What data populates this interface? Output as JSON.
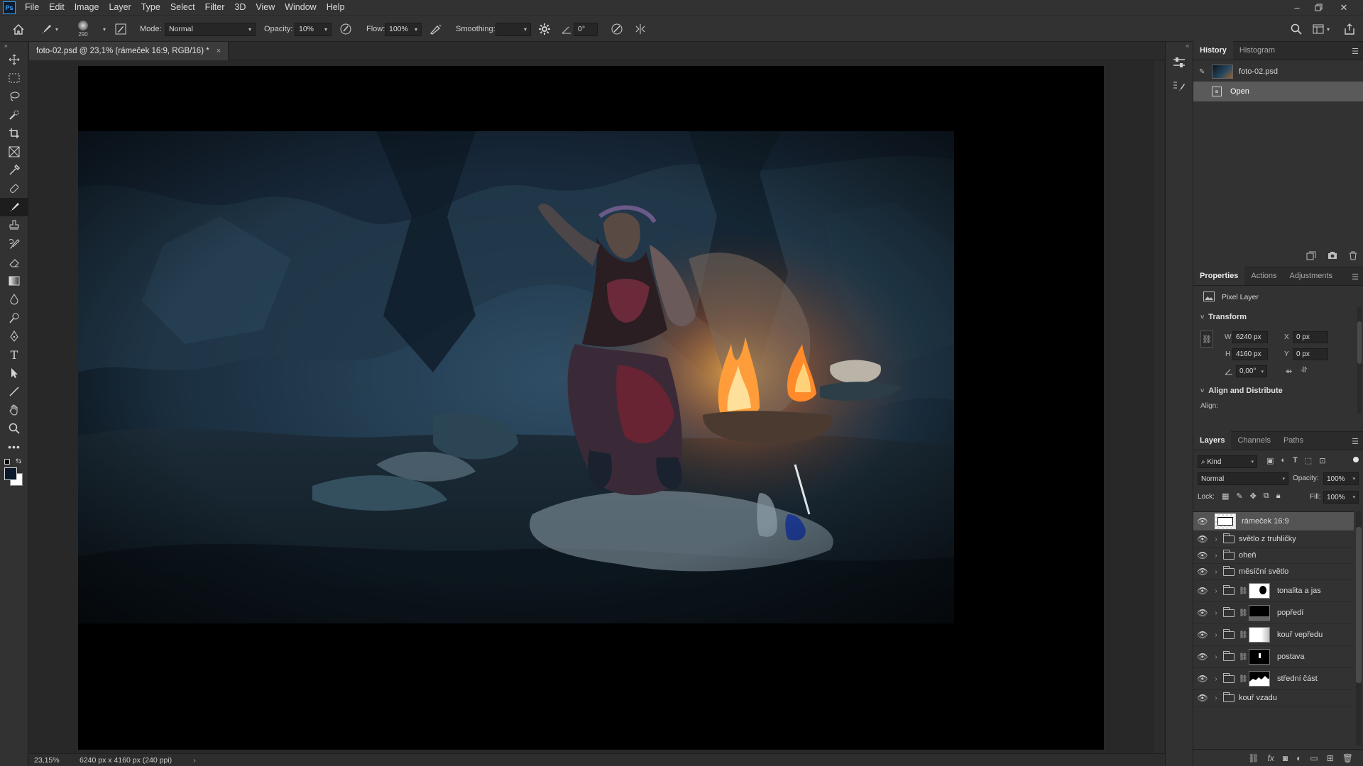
{
  "app": {
    "logo": "Ps"
  },
  "menu": [
    "File",
    "Edit",
    "Image",
    "Layer",
    "Type",
    "Select",
    "Filter",
    "3D",
    "View",
    "Window",
    "Help"
  ],
  "options": {
    "brush_size": "290",
    "mode_label": "Mode:",
    "mode_value": "Normal",
    "opacity_label": "Opacity:",
    "opacity_value": "10%",
    "flow_label": "Flow:",
    "flow_value": "100%",
    "smoothing_label": "Smoothing:",
    "smoothing_value": "",
    "angle_value": "0°"
  },
  "document": {
    "tab_title": "foto-02.psd @ 23,1% (rámeček 16:9, RGB/16) *",
    "close_glyph": "×"
  },
  "status": {
    "zoom": "23,15%",
    "info": "6240 px x 4160 px (240 ppi)",
    "arrow": "›"
  },
  "history": {
    "tabs": [
      "History",
      "Histogram"
    ],
    "snapshot_label": "foto-02.psd",
    "items": [
      "Open"
    ]
  },
  "properties": {
    "tabs": [
      "Properties",
      "Actions",
      "Adjustments"
    ],
    "layer_type": "Pixel Layer",
    "transform_title": "Transform",
    "w_label": "W",
    "w_value": "6240 px",
    "h_label": "H",
    "h_value": "4160 px",
    "x_label": "X",
    "x_value": "0 px",
    "y_label": "Y",
    "y_value": "0 px",
    "angle_value": "0,00°",
    "align_title": "Align and Distribute",
    "align_label": "Align:"
  },
  "layers": {
    "tabs": [
      "Layers",
      "Channels",
      "Paths"
    ],
    "filter_kind": "Kind",
    "blend_mode": "Normal",
    "opacity_label": "Opacity:",
    "opacity_value": "100%",
    "lock_label": "Lock:",
    "fill_label": "Fill:",
    "fill_value": "100%",
    "items": [
      {
        "name": "rámeček 16:9",
        "type": "pixel"
      },
      {
        "name": "světlo z truhličky",
        "type": "group"
      },
      {
        "name": "oheň",
        "type": "group"
      },
      {
        "name": "měsíční světlo",
        "type": "group"
      },
      {
        "name": "tonalita a jas",
        "type": "group-mask"
      },
      {
        "name": "popředí",
        "type": "group-mask"
      },
      {
        "name": "kouř vepředu",
        "type": "group-mask"
      },
      {
        "name": "postava",
        "type": "group-mask"
      },
      {
        "name": "střední část",
        "type": "group-mask"
      },
      {
        "name": "kouř vzadu",
        "type": "group"
      }
    ]
  },
  "colors": {
    "accent": "#31a8ff",
    "panel_bg": "#323232",
    "canvas_bg": "#282828",
    "selected_row": "#545454"
  }
}
